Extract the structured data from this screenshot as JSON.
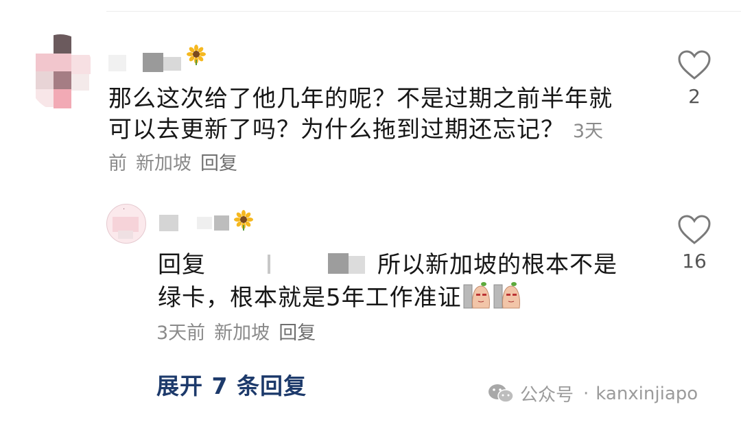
{
  "comments": [
    {
      "text": "那么这次给了他几年的呢？不是过期之前半年就可以去更新了吗？为什么拖到过期还忘记？",
      "time": "3天前",
      "location": "新加坡",
      "reply_label": "回复",
      "likes": "2"
    },
    {
      "reply_prefix": "回复",
      "mention_tail": "：",
      "text": "所以新加坡的根本不是绿卡，根本就是5年工作准证",
      "time": "3天前",
      "location": "新加坡",
      "reply_label": "回复",
      "likes": "16"
    }
  ],
  "expand_replies": "展开 7 条回复",
  "watermark": {
    "source": "公众号",
    "dot": "·",
    "account": "kanxinjiapo"
  },
  "icons": {
    "like": "heart-outline-icon",
    "badge": "sunflower-icon",
    "sticker": "face-sticker-icon",
    "watermark": "wechat-icon"
  }
}
